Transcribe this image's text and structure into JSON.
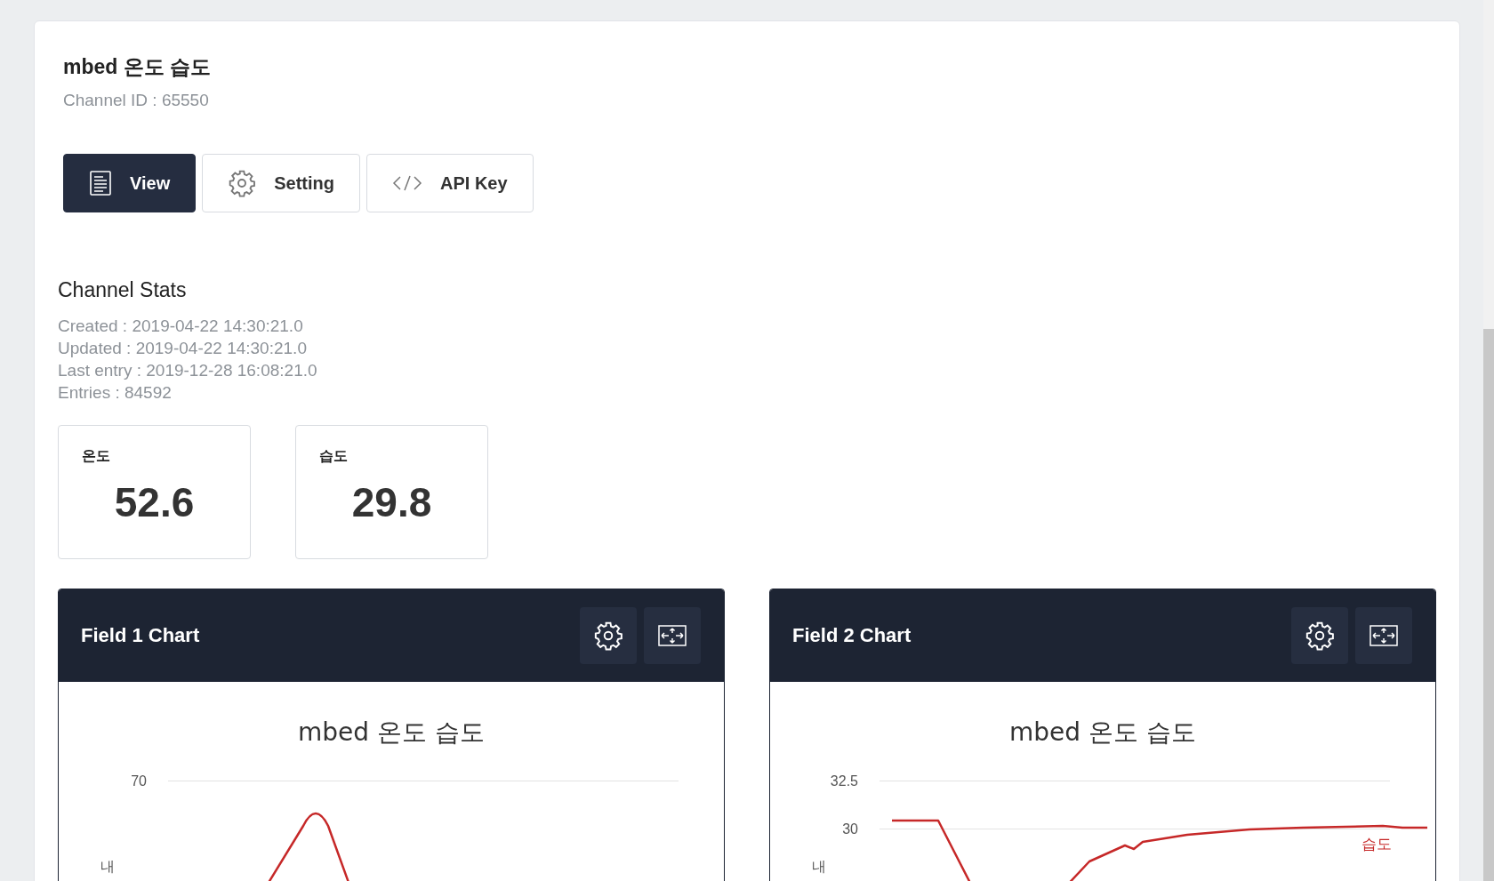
{
  "channel": {
    "title": "mbed 온도 습도",
    "channel_id": "Channel ID : 65550"
  },
  "tabs": [
    {
      "label": "View",
      "selected": true
    },
    {
      "label": "Setting",
      "selected": false
    },
    {
      "label": "API Key",
      "selected": false
    }
  ],
  "stats": {
    "title": "Channel Stats",
    "lines": [
      "Created : 2019-04-22 14:30:21.0",
      "Updated : 2019-04-22 14:30:21.0",
      "Last entry : 2019-12-28 16:08:21.0",
      "Entries : 84592"
    ]
  },
  "fields": [
    {
      "label": "온도",
      "value": "52.6"
    },
    {
      "label": "습도",
      "value": "29.8"
    }
  ],
  "charts": [
    {
      "header": "Field 1 Chart",
      "title": "mbed 온도 습도",
      "y_axis_label": "내",
      "y_ticks": [
        "70"
      ]
    },
    {
      "header": "Field 2 Chart",
      "title": "mbed 온도 습도",
      "y_axis_label": "내",
      "y_ticks": [
        "32.5",
        "30"
      ],
      "series_label": "습도"
    }
  ]
}
